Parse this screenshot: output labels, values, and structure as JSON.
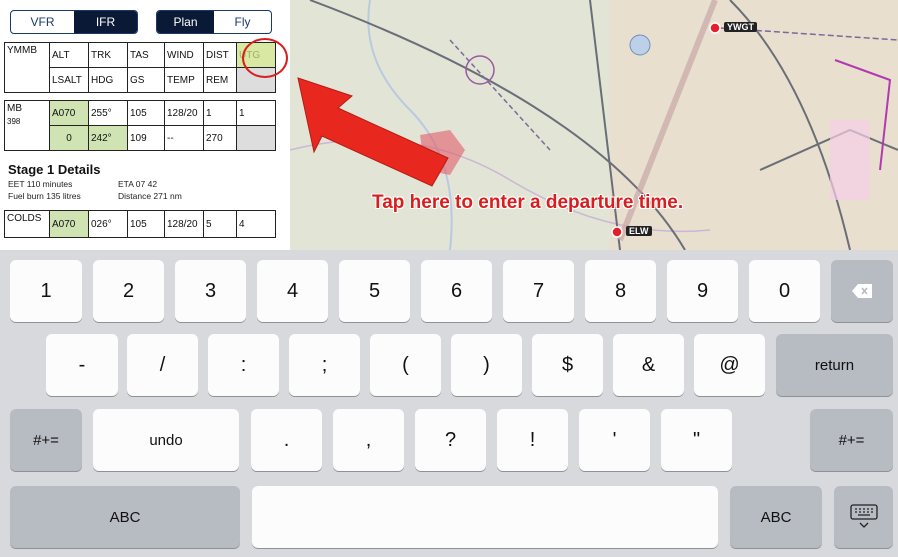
{
  "modes": {
    "vfr": "VFR",
    "ifr": "IFR",
    "plan": "Plan",
    "fly": "Fly"
  },
  "leg1": {
    "waypoint": "YMMB",
    "h1": [
      "ALT",
      "TRK",
      "TAS",
      "WIND",
      "DIST",
      "UTG"
    ],
    "h2": [
      "LSALT",
      "HDG",
      "GS",
      "TEMP",
      "REM",
      ""
    ]
  },
  "leg2": {
    "waypoint": "MB",
    "sub": "398",
    "r1": [
      "A070",
      "255°",
      "105",
      "128/20",
      "1",
      "1"
    ],
    "r2": [
      "0",
      "242°",
      "109",
      "--",
      "270",
      ""
    ]
  },
  "stage": {
    "title": "Stage 1 Details",
    "eet": "EET 110 minutes",
    "eta": "ETA 07 42",
    "fuel": "Fuel burn 135 litres",
    "dist": "Distance 271 nm"
  },
  "leg3": {
    "waypoint": "COLDS",
    "r1": [
      "A070",
      "026°",
      "105",
      "128/20",
      "5",
      "4"
    ]
  },
  "map": {
    "hint": "Tap here to enter a departure time.",
    "wpt1": "YWGT",
    "wpt2": "ELW"
  },
  "keyboard": {
    "row1": [
      "1",
      "2",
      "3",
      "4",
      "5",
      "6",
      "7",
      "8",
      "9",
      "0"
    ],
    "row2": [
      "-",
      "/",
      ":",
      ";",
      "(",
      ")",
      "$",
      "&",
      "@"
    ],
    "return": "return",
    "symbols": "#+=",
    "undo": "undo",
    "row3": [
      ".",
      ",",
      "?",
      "!",
      "'",
      "\""
    ],
    "abc": "ABC",
    "space": "",
    "colors": {
      "key": "#fcfcfd",
      "dark_key": "#b7bbc2",
      "background": "#d7d9dd",
      "accent": "#d81e1e"
    }
  }
}
